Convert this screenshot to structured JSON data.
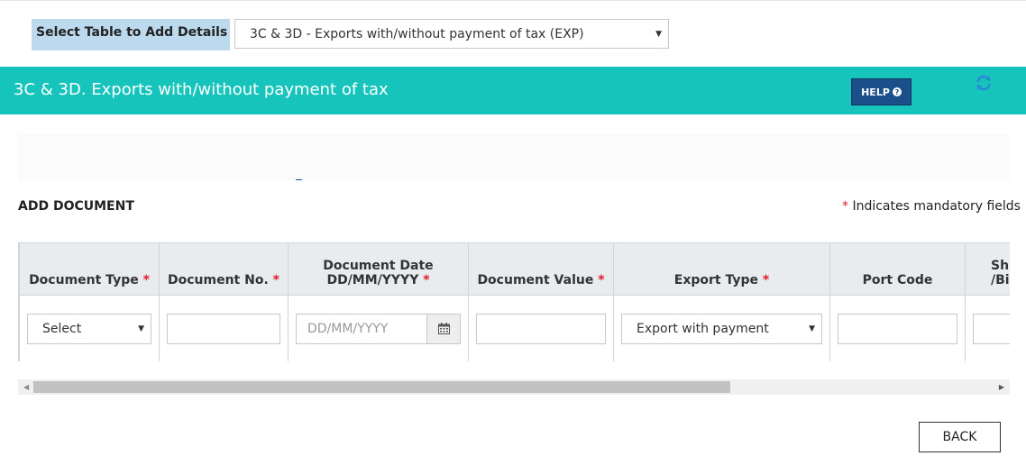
{
  "top_selector": {
    "label": "Select Table to Add Details",
    "selected": "3C & 3D - Exports with/without payment of tax (EXP)"
  },
  "section": {
    "title": "3C & 3D. Exports with/without payment of tax",
    "help_label": "HELP",
    "refresh_icon": "refresh-icon",
    "header_color": "#17c4bb"
  },
  "add_document": {
    "title": "ADD DOCUMENT",
    "mandatory_marker": "*",
    "mandatory_text": "Indicates mandatory fields"
  },
  "table": {
    "columns": [
      {
        "label": "Document Type",
        "label_line2": "",
        "required": true
      },
      {
        "label": "Document No.",
        "label_line2": "",
        "required": true
      },
      {
        "label": "Document Date",
        "label_line2": "DD/MM/YYYY",
        "required": true
      },
      {
        "label": "Document Value",
        "label_line2": "",
        "required": true
      },
      {
        "label": "Export Type",
        "label_line2": "",
        "required": true
      },
      {
        "label": "Port Code",
        "label_line2": "",
        "required": false
      },
      {
        "label": "Sh",
        "label_line2": "/Bi",
        "required": false
      }
    ],
    "row": {
      "document_type": "Select",
      "document_no": "",
      "document_date_placeholder": "DD/MM/YYYY",
      "document_value": "",
      "export_type": "Export with payment",
      "port_code": "",
      "shipping_bill": ""
    }
  },
  "buttons": {
    "back": "BACK"
  },
  "colors": {
    "required": "#e0192b",
    "help_button": "#1b4f8a",
    "label_bg": "#bcd9ee"
  }
}
